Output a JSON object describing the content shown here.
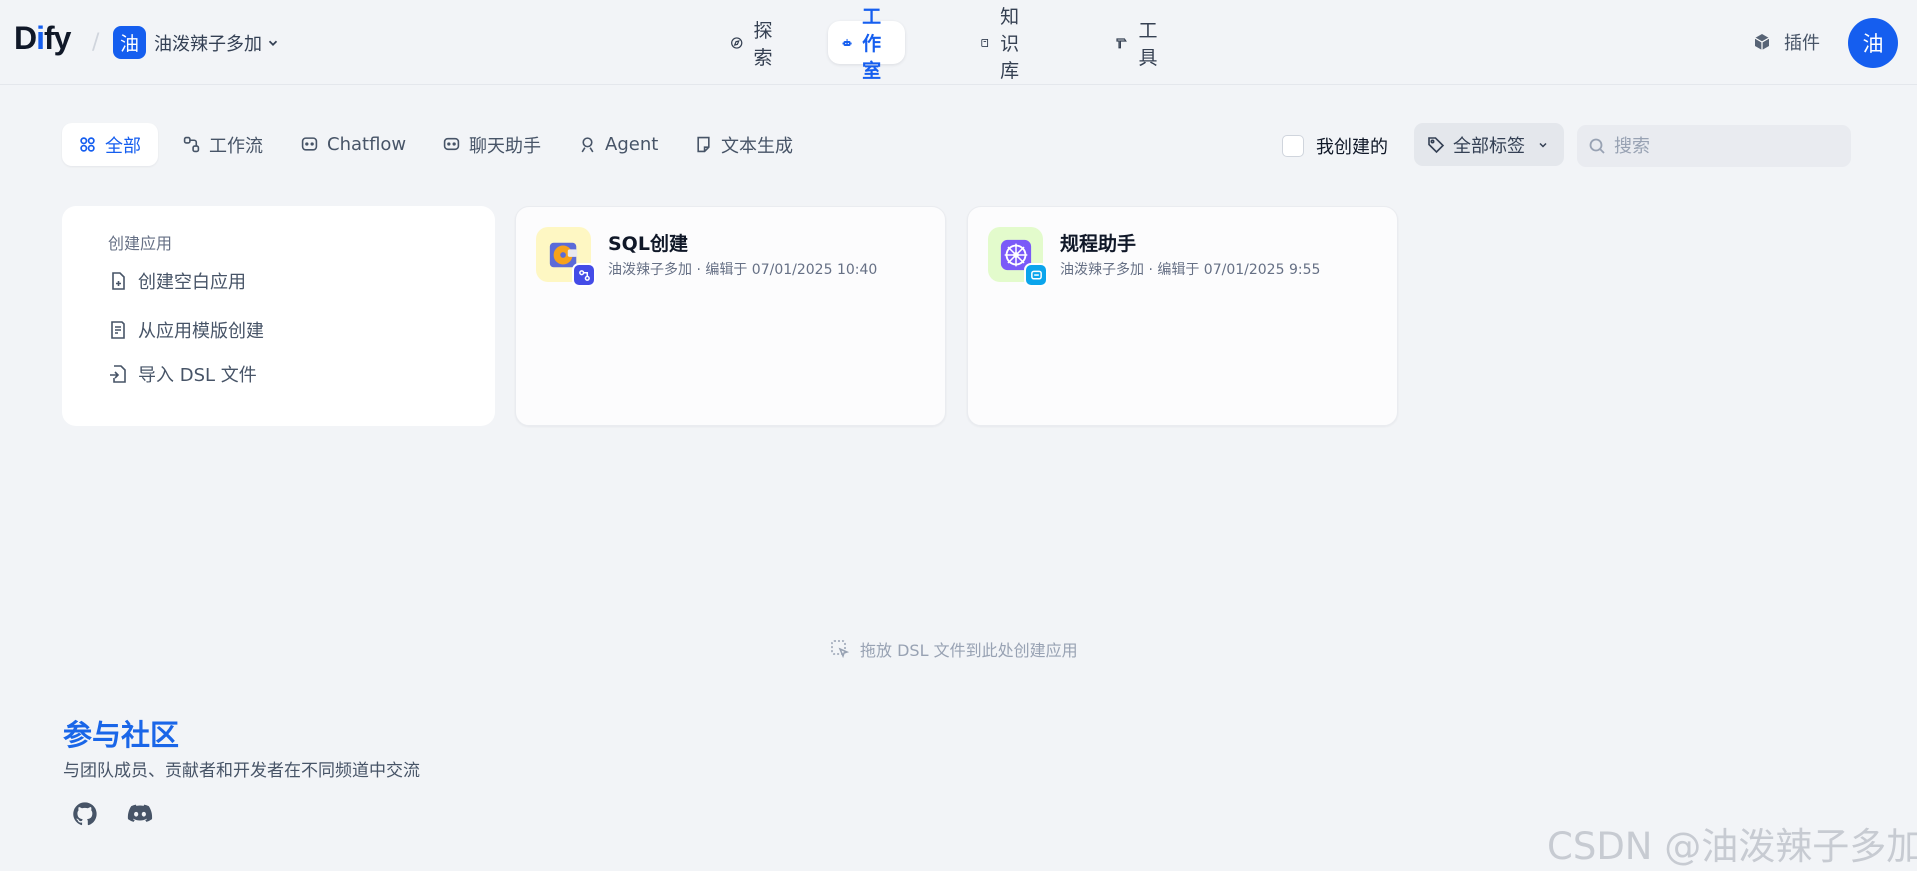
{
  "header": {
    "logo_prefix": "D",
    "logo_accent": "i",
    "logo_suffix": "fy",
    "workspace_initial": "油",
    "workspace_name": "油泼辣子多加",
    "nav": [
      {
        "label": "探索",
        "icon": "compass-icon"
      },
      {
        "label": "工作室",
        "icon": "robot-icon",
        "active": true
      },
      {
        "label": "知识库",
        "icon": "book-icon"
      },
      {
        "label": "工具",
        "icon": "hammer-icon"
      }
    ],
    "plugins_label": "插件",
    "avatar_initial": "油"
  },
  "filters": {
    "tabs": [
      {
        "label": "全部",
        "icon": "grid-icon",
        "active": true
      },
      {
        "label": "工作流",
        "icon": "workflow-icon"
      },
      {
        "label": "Chatflow",
        "icon": "chatflow-icon"
      },
      {
        "label": "聊天助手",
        "icon": "chat-bot-icon"
      },
      {
        "label": "Agent",
        "icon": "agent-icon"
      },
      {
        "label": "文本生成",
        "icon": "text-note-icon"
      }
    ],
    "mine_label": "我创建的",
    "tag_label": "全部标签",
    "search_placeholder": "搜索"
  },
  "create": {
    "title": "创建应用",
    "items": [
      "创建空白应用",
      "从应用模版创建",
      "导入 DSL 文件"
    ]
  },
  "apps": [
    {
      "name": "SQL创建",
      "meta": "油泼辣子多加 · 编辑于 07/01/2025 10:40",
      "icon": "disc-icon",
      "icon_bg": "#fef7c3",
      "badge": "workflow-badge-icon",
      "badge_bg": "#444ce7"
    },
    {
      "name": "规程助手",
      "meta": "油泼辣子多加 · 编辑于 07/01/2025 9:55",
      "icon": "wheel-icon",
      "icon_bg": "#e3fbcc",
      "badge": "chat-badge-icon",
      "badge_bg": "#0ba5ec"
    }
  ],
  "drop_hint": "拖放 DSL 文件到此处创建应用",
  "community": {
    "title": "参与社区",
    "subtitle": "与团队成员、贡献者和开发者在不同频道中交流"
  },
  "watermark": "CSDN @油泼辣子多加"
}
